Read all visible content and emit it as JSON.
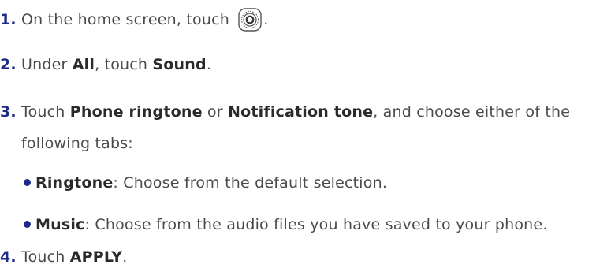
{
  "steps": [
    {
      "number": "1.",
      "text_before": "On the home screen, touch",
      "icon": "settings-icon",
      "text_after": "."
    },
    {
      "number": "2.",
      "text_a": "Under ",
      "bold_a": "All",
      "text_b": ", touch ",
      "bold_b": "Sound",
      "text_c": "."
    },
    {
      "number": "3.",
      "text_a": "Touch ",
      "bold_a": "Phone ringtone",
      "text_b": " or ",
      "bold_b": "Notification tone",
      "text_c": ", and choose either of the",
      "continuation": "following tabs:",
      "bullets": [
        {
          "bold": "Ringtone",
          "text": ": Choose from the default selection."
        },
        {
          "bold": "Music",
          "text": ": Choose from the audio files you have saved to your phone."
        }
      ]
    },
    {
      "number": "4.",
      "text_a": "Touch ",
      "bold_a": "APPLY",
      "text_b": "."
    }
  ],
  "colors": {
    "number": "#1d2a8a",
    "text": "#4a4a4a",
    "bold": "#2a2a2a"
  }
}
